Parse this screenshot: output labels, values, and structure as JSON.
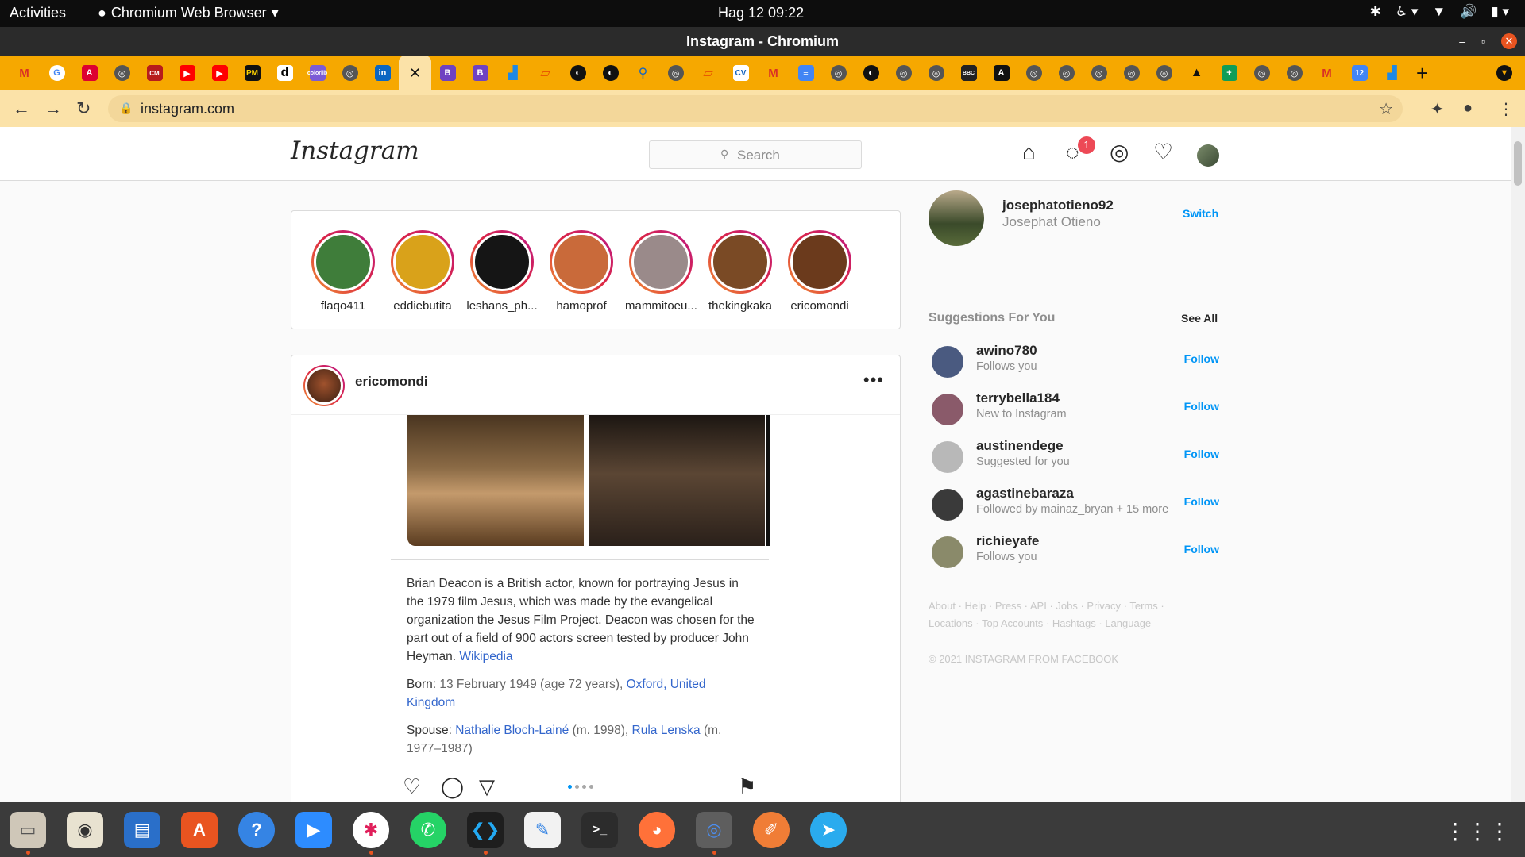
{
  "system": {
    "activities": "Activities",
    "app_menu": "Chromium Web Browser",
    "clock": "Hag 12  09:22"
  },
  "window": {
    "title": "Instagram - Chromium"
  },
  "browser": {
    "url": "instagram.com"
  },
  "instagram": {
    "logo": "Instagram",
    "search_placeholder": "Search",
    "messages_badge": "1",
    "stories": [
      {
        "name": "flaqo411",
        "color": "#3f7d3a"
      },
      {
        "name": "eddiebutita",
        "color": "#d9a21a"
      },
      {
        "name": "leshans_ph...",
        "color": "#151515"
      },
      {
        "name": "hamoprof",
        "color": "#c96a3a"
      },
      {
        "name": "mammitoeu...",
        "color": "#9a8a8a"
      },
      {
        "name": "thekingkaka",
        "color": "#7a4a25"
      },
      {
        "name": "ericomondi",
        "color": "#6b3a1c"
      }
    ],
    "post": {
      "username": "ericomondi",
      "more": "•••",
      "wiki_text": "Brian Deacon is a British actor, known for portraying Jesus in the 1979 film Jesus, which was made by the evangelical organization the Jesus Film Project. Deacon was chosen for the part out of a field of 900 actors screen tested by producer John Heyman.",
      "wiki_link": "Wikipedia",
      "born_label": "Born:",
      "born_value": "13 February 1949 (age 72 years),",
      "born_place": "Oxford, United Kingdom",
      "spouse_label": "Spouse:",
      "spouse_1": "Nathalie Bloch-Lainé",
      "spouse_1_years": "(m. 1998),",
      "spouse_2": "Rula Lenska",
      "spouse_2_years": "(m. 1977–1987)"
    },
    "sidebar": {
      "username": "josephatotieno92",
      "full_name": "Josephat Otieno",
      "switch": "Switch",
      "suggestions_title": "Suggestions For You",
      "see_all": "See All",
      "suggestions": [
        {
          "username": "awino780",
          "subtitle": "Follows you",
          "action": "Follow",
          "color": "#4a5a80"
        },
        {
          "username": "terrybella184",
          "subtitle": "New to Instagram",
          "action": "Follow",
          "color": "#8a5a6a"
        },
        {
          "username": "austinendege",
          "subtitle": "Suggested for you",
          "action": "Follow",
          "color": "#b8b8b8"
        },
        {
          "username": "agastinebaraza",
          "subtitle": "Followed by mainaz_bryan + 15 more",
          "action": "Follow",
          "color": "#3a3a3a"
        },
        {
          "username": "richieyafe",
          "subtitle": "Follows you",
          "action": "Follow",
          "color": "#8a8a6a"
        }
      ],
      "footer_line1": "About · Help · Press · API · Jobs · Privacy · Terms ·",
      "footer_line2": "Locations · Top Accounts · Hashtags · Language",
      "copyright": "© 2021 INSTAGRAM FROM FACEBOOK"
    }
  }
}
